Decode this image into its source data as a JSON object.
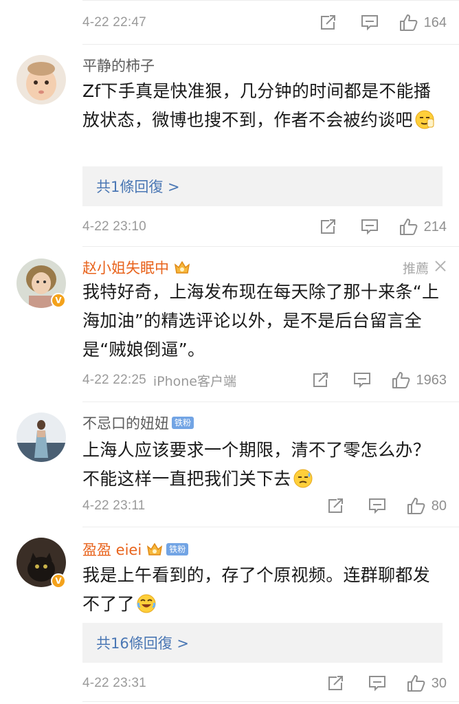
{
  "comments": [
    {
      "time": "4-22 22:47",
      "likes": "164"
    },
    {
      "user": "平静的柿子",
      "text": "Zf下手真是快准狠，几分钟的时间都是不能播放状态，微博也搜不到，作者不会被约谈吧",
      "emoji": "smirk-emoji",
      "replies": "共1條回復 >",
      "time": "4-22 23:10",
      "likes": "214"
    },
    {
      "user": "赵小姐失眠中",
      "recommend_label": "推薦",
      "text": "我特好奇，上海发布现在每天除了那十来条“上海加油”的精选评论以外，是不是后台留言全是“贼娘倒逼”。",
      "time": "4-22 22:25",
      "source": "iPhone客户端",
      "likes": "1963"
    },
    {
      "user": "不忌口的妞妞",
      "fan_badge": "铁粉",
      "text": "上海人应该要求一个期限，清不了零怎么办？不能这样一直把我们关下去",
      "emoji": "sweat-emoji",
      "time": "4-22 23:11",
      "likes": "80"
    },
    {
      "user": "盈盈 eiei",
      "fan_badge": "铁粉",
      "text": "我是上午看到的，存了个原视频。连群聊都发不了了",
      "emoji": "laugh-cry-emoji",
      "replies": "共16條回復 >",
      "time": "4-22 23:31",
      "likes": "30"
    }
  ],
  "colors": {
    "vip_name": "#e8631c",
    "link_blue": "#4a77b4",
    "meta_gray": "#9a9a9a",
    "fan_badge_bg": "#72a4e4"
  }
}
